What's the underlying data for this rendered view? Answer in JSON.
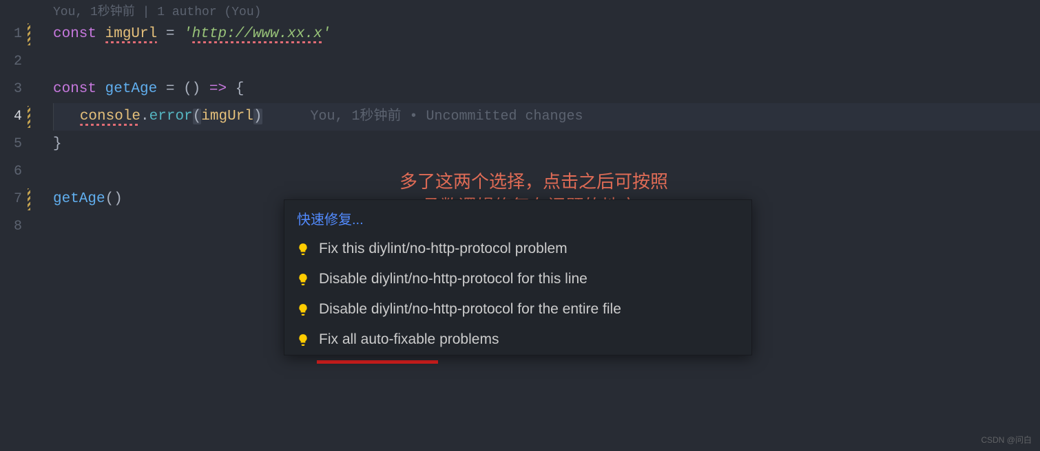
{
  "codelens": "You, 1秒钟前 | 1 author (You)",
  "lines": {
    "l1": {
      "const": "const ",
      "var": "imgUrl",
      "eq": " = ",
      "q1": "'",
      "str": "http://www.xx.x",
      "q2": "'"
    },
    "l3": {
      "const": "const ",
      "fn": "getAge",
      "eq": " = ",
      "paren": "()",
      "arrow": " => ",
      "brace": "{"
    },
    "l4": {
      "indent": "   ",
      "obj": "console",
      "dot": ".",
      "prop": "error",
      "open": "(",
      "arg": "imgUrl",
      "close": ")"
    },
    "l5": {
      "brace": "}"
    },
    "l7": {
      "fn": "getAge",
      "call": "()"
    }
  },
  "blame": "You, 1秒钟前 • Uncommitted changes",
  "annotation": {
    "line1": "多了这两个选择，点击之后可按照",
    "line2": "fix 函数逻辑修复有问题的地方"
  },
  "quickfix": {
    "header": "快速修复...",
    "items": [
      "Fix this diylint/no-http-protocol problem",
      "Disable diylint/no-http-protocol for this line",
      "Disable diylint/no-http-protocol for the entire file",
      "Fix all auto-fixable problems"
    ]
  },
  "watermark": "CSDN @问白",
  "line_numbers": [
    "1",
    "2",
    "3",
    "4",
    "5",
    "6",
    "7",
    "8"
  ],
  "active_line": 4
}
